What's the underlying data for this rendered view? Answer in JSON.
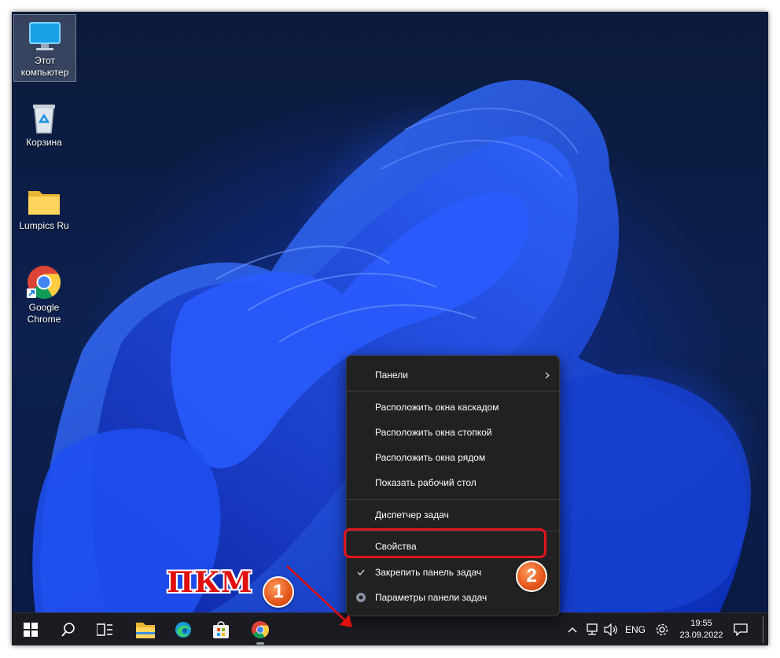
{
  "desktop": {
    "icons": [
      {
        "label": "Этот компьютер",
        "icon": "monitor-icon"
      },
      {
        "label": "Корзина",
        "icon": "recycle-bin-icon"
      },
      {
        "label": "Lumpics Ru",
        "icon": "folder-icon"
      },
      {
        "label": "Google Chrome",
        "icon": "chrome-icon"
      }
    ]
  },
  "context_menu": {
    "items": [
      {
        "label": "Панели",
        "submenu": true
      },
      {
        "label": "Расположить окна каскадом"
      },
      {
        "label": "Расположить окна стопкой"
      },
      {
        "label": "Расположить окна рядом"
      },
      {
        "label": "Показать рабочий стол"
      },
      {
        "label": "Диспетчер задач"
      },
      {
        "label": "Свойства"
      },
      {
        "label": "Закрепить панель задач",
        "checked": true
      },
      {
        "label": "Параметры панели задач"
      }
    ]
  },
  "annotations": {
    "step1_text": "ПКМ",
    "step1_badge": "1",
    "step2_badge": "2",
    "highlight_color": "#e0141c",
    "badge_color": "#e4561a"
  },
  "taskbar": {
    "apps": [
      "start-icon",
      "search-icon",
      "task-view-icon",
      "file-explorer-icon",
      "edge-icon",
      "store-icon",
      "chrome-icon"
    ],
    "tray": {
      "language": "ENG",
      "time": "19:55",
      "date": "23.09.2022"
    }
  }
}
